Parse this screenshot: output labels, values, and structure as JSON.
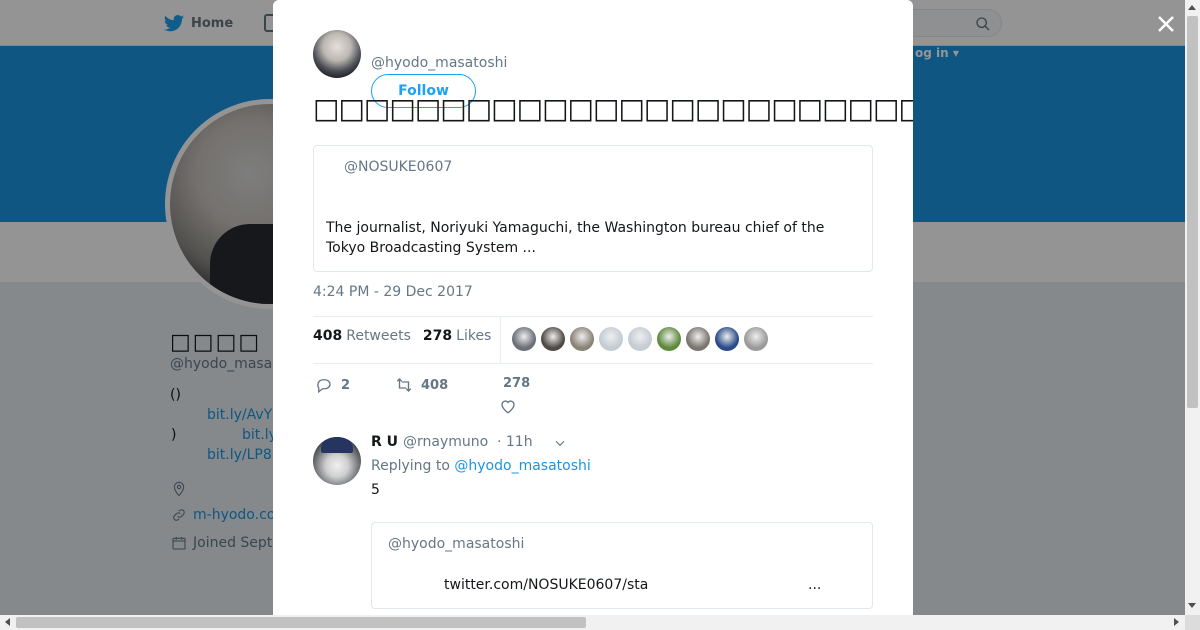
{
  "nav": {
    "home_label": "Home",
    "login_label": "og in ▾"
  },
  "profile": {
    "name": "□□□□",
    "handle": "@hyodo_masa",
    "bio_line1": "()",
    "bio_link1": "bit.ly/AvY",
    "bio_line2": ")",
    "bio_link2": "bit.ly",
    "bio_link3": "bit.ly/LP8",
    "website": "m-hyodo.co",
    "joined": "Joined Septe"
  },
  "tweet": {
    "author_handle": "@hyodo_masatoshi",
    "follow_label": "Follow",
    "text": "□□□□□□□□□□□□□□□□□□□□□□□□□□□□□□□□□□□□□□□□□□□□□□□□□□□□□□□□□□",
    "quote": {
      "handle": "@NOSUKE0607",
      "text": "The journalist, Noriyuki Yamaguchi, the Washington bureau chief of the Tokyo Broadcasting System  ..."
    },
    "timestamp": "4:24 PM - 29 Dec 2017",
    "retweets_count": "408",
    "retweets_label": "Retweets",
    "likes_count": "278",
    "likes_label": "Likes",
    "liker_colors": [
      "#6b6f78",
      "#4f4a45",
      "#8a8377",
      "#c4ccd4",
      "#c4ccd4",
      "#5d8a3c",
      "#7a7570",
      "#2a4a8a",
      "#9a9a9a"
    ],
    "actions": {
      "reply_count": "2",
      "retweet_count": "408",
      "like_count": "278"
    }
  },
  "reply": {
    "name": "R U",
    "handle": "@rnaymuno",
    "time": "· 11h",
    "replying_prefix": "Replying to",
    "replying_to": "@hyodo_masatoshi",
    "text": "5",
    "quote_handle": "@hyodo_masatoshi",
    "quote_link": "twitter.com/NOSUKE0607/sta",
    "quote_ellipsis": "..."
  },
  "colors": {
    "brand": "#1da1f2",
    "banner": "#1b95e0",
    "link": "#1b95e0"
  }
}
